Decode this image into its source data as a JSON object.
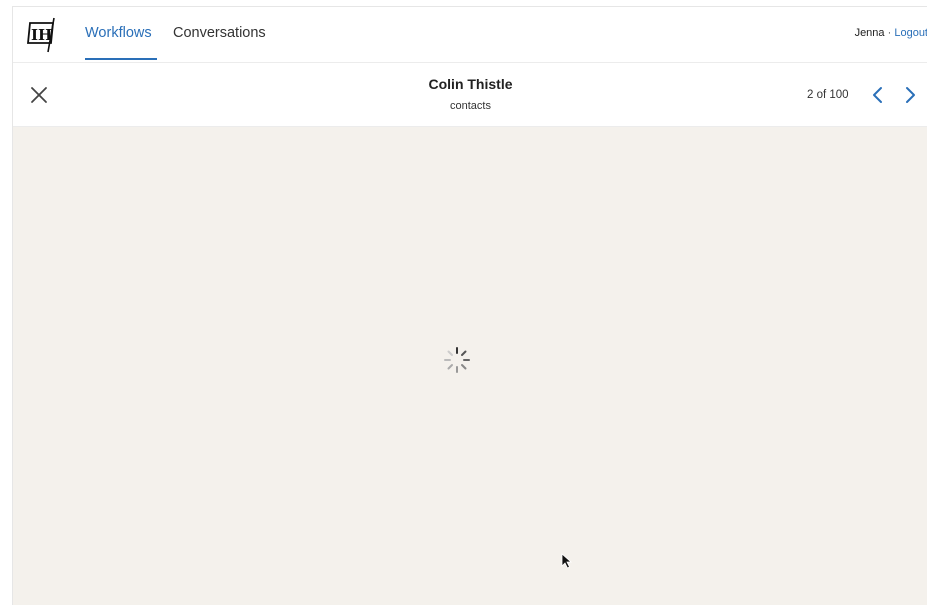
{
  "nav": {
    "tabs": [
      {
        "label": "Workflows",
        "active": true
      },
      {
        "label": "Conversations",
        "active": false
      }
    ],
    "user_name": "Jenna",
    "separator": "·",
    "logout_label": "Logout",
    "logo_icon": "brand-logo-icon"
  },
  "record": {
    "title": "Colin Thistle",
    "subtitle": "contacts",
    "pager_text": "2 of 100"
  },
  "icons": {
    "close": "close-icon",
    "prev": "chevron-left-icon",
    "next": "chevron-right-icon",
    "spinner": "loading-spinner-icon"
  },
  "colors": {
    "accent": "#2a6fb8",
    "content_bg": "#f4f1ec"
  }
}
